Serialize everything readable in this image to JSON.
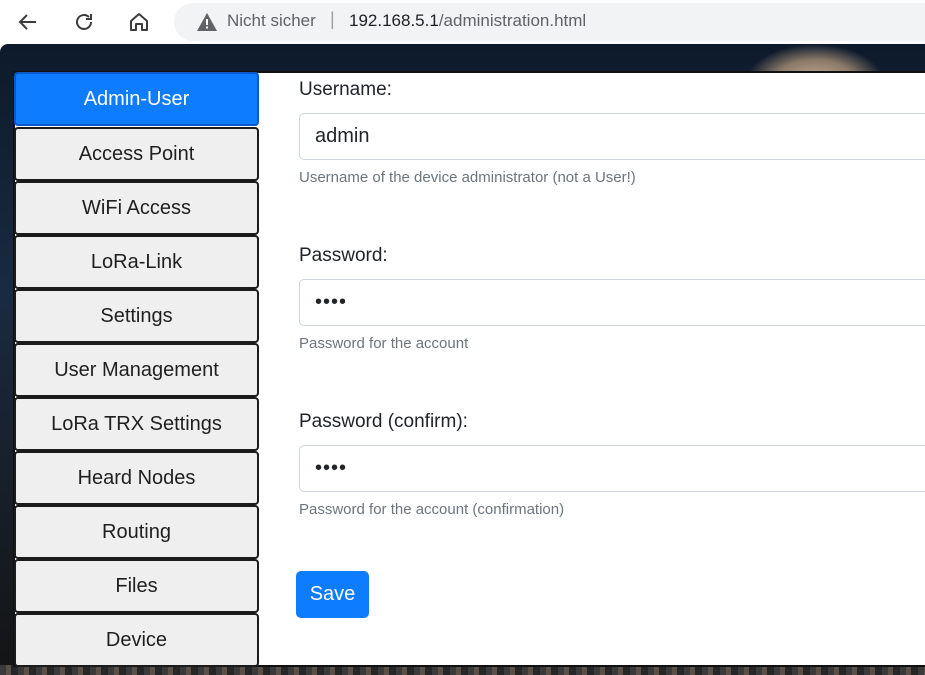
{
  "browser": {
    "security_label": "Nicht sicher",
    "separator": "|",
    "url_host": "192.168.5.1",
    "url_path": "/administration.html"
  },
  "sidebar": {
    "items": [
      {
        "label": "Admin-User",
        "active": true
      },
      {
        "label": "Access Point",
        "active": false
      },
      {
        "label": "WiFi Access",
        "active": false
      },
      {
        "label": "LoRa-Link",
        "active": false
      },
      {
        "label": "Settings",
        "active": false
      },
      {
        "label": "User Management",
        "active": false
      },
      {
        "label": "LoRa TRX Settings",
        "active": false
      },
      {
        "label": "Heard Nodes",
        "active": false
      },
      {
        "label": "Routing",
        "active": false
      },
      {
        "label": "Files",
        "active": false
      },
      {
        "label": "Device",
        "active": false
      }
    ]
  },
  "form": {
    "username": {
      "label": "Username:",
      "value": "admin",
      "help": "Username of the device administrator (not a User!)"
    },
    "password": {
      "label": "Password:",
      "value": "••••",
      "help": "Password for the account"
    },
    "password_confirm": {
      "label": "Password (confirm):",
      "value": "••••",
      "help": "Password for the account (confirmation)"
    },
    "save_label": "Save"
  },
  "colors": {
    "accent": "#0d7cff",
    "sidebar_bg": "#efefef",
    "help_text": "#6c757d"
  }
}
